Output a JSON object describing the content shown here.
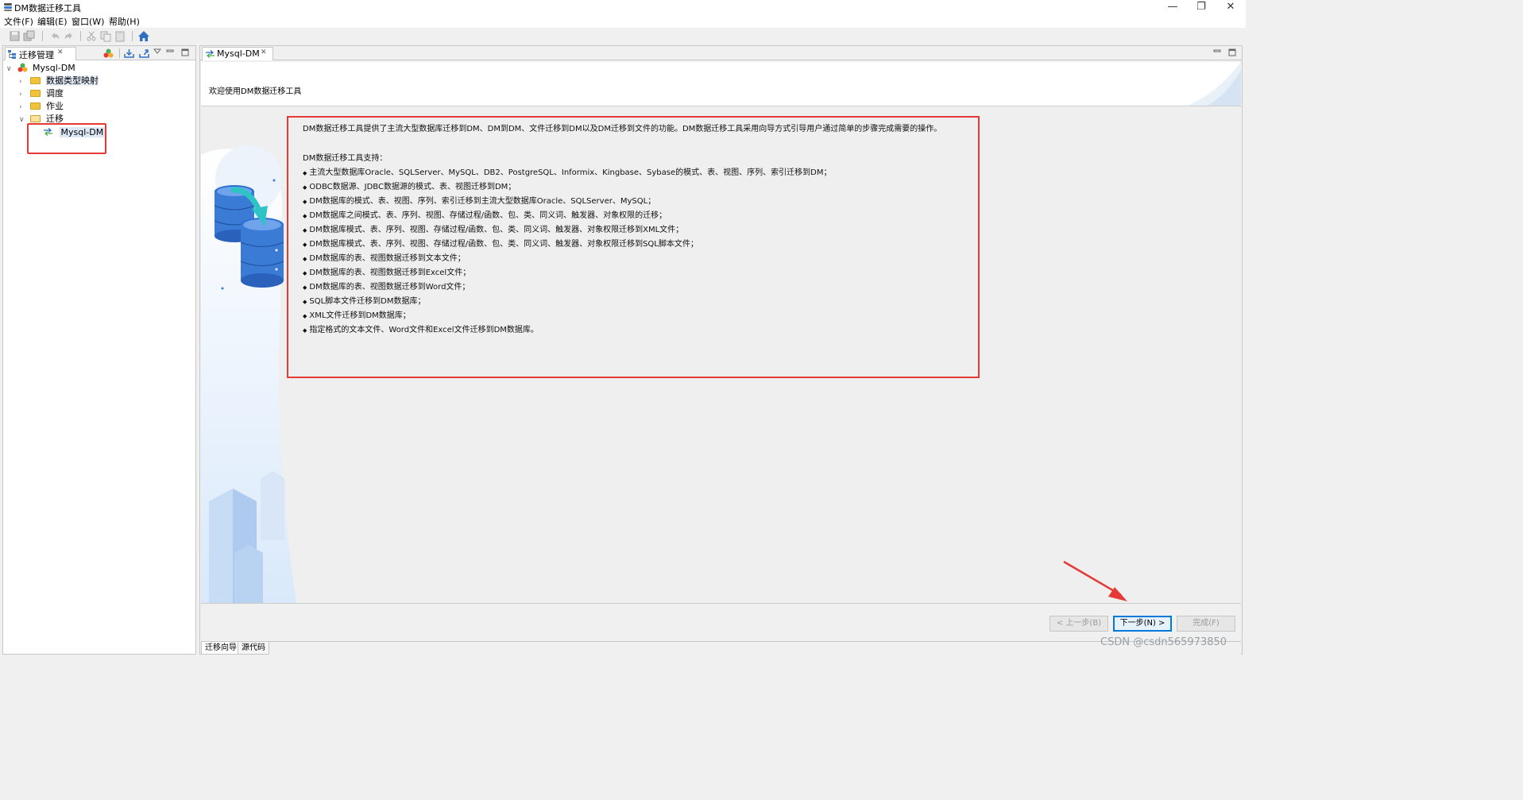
{
  "window": {
    "title": "DM数据迁移工具",
    "minimize_glyph": "—",
    "restore_glyph": "❐",
    "close_glyph": "✕"
  },
  "menu": {
    "items": [
      {
        "label": "文件(F)"
      },
      {
        "label": "编辑(E)"
      },
      {
        "label": "窗口(W)"
      },
      {
        "label": "帮助(H)"
      }
    ]
  },
  "toolbar": {
    "icons": [
      "save-icon",
      "save-all-icon",
      "undo-icon",
      "redo-icon",
      "cut-icon",
      "copy-icon",
      "paste-icon",
      "home-icon"
    ]
  },
  "left_panel": {
    "tab_label": "迁移管理",
    "close_glyph": "✕",
    "tree": {
      "root": "Mysql-DM",
      "items": [
        {
          "label": "数据类型映射",
          "expanded": false
        },
        {
          "label": "调度",
          "expanded": false
        },
        {
          "label": "作业",
          "expanded": false
        },
        {
          "label": "迁移",
          "expanded": true
        }
      ],
      "selected_child": "Mysql-DM"
    },
    "annotation_color": "#e53935"
  },
  "editor": {
    "tab_label": "Mysql-DM",
    "close_glyph": "✕",
    "welcome_title": "欢迎使用DM数据迁移工具",
    "intro": "DM数据迁移工具提供了主流大型数据库迁移到DM、DM到DM、文件迁移到DM以及DM迁移到文件的功能。DM数据迁移工具采用向导方式引导用户通过简单的步骤完成需要的操作。",
    "support_title": "DM数据迁移工具支持：",
    "bullets": [
      "主流大型数据库Oracle、SQLServer、MySQL、DB2、PostgreSQL、Informix、Kingbase、Sybase的模式、表、视图、序列、索引迁移到DM；",
      "ODBC数据源、JDBC数据源的模式、表、视图迁移到DM；",
      "DM数据库的模式、表、视图、序列、索引迁移到主流大型数据库Oracle、SQLServer、MySQL；",
      "DM数据库之间模式、表、序列、视图、存储过程/函数、包、类、同义词、触发器、对象权限的迁移；",
      "DM数据库模式、表、序列、视图、存储过程/函数、包、类、同义词、触发器、对象权限迁移到XML文件；",
      "DM数据库模式、表、序列、视图、存储过程/函数、包、类、同义词、触发器、对象权限迁移到SQL脚本文件；",
      "DM数据库的表、视图数据迁移到文本文件；",
      "DM数据库的表、视图数据迁移到Excel文件；",
      "DM数据库的表、视图数据迁移到Word文件；",
      "SQL脚本文件迁移到DM数据库；",
      "XML文件迁移到DM数据库；",
      "指定格式的文本文件、Word文件和Excel文件迁移到DM数据库。"
    ],
    "bullet_glyph": "◆"
  },
  "wizard_buttons": {
    "back": "< 上一步(B)",
    "next": "下一步(N) >",
    "finish": "完成(F)"
  },
  "bottom_tabs": [
    {
      "label": "迁移向导",
      "active": true
    },
    {
      "label": "源代码",
      "active": false
    }
  ],
  "watermark": "CSDN @csdn565973850",
  "colors": {
    "accent_blue": "#0078d7",
    "annotation_red": "#e53935",
    "folder_yellow": "#f2c23a",
    "db_blue": "#3a7bd5",
    "arrow_teal": "#2ec4c6"
  }
}
